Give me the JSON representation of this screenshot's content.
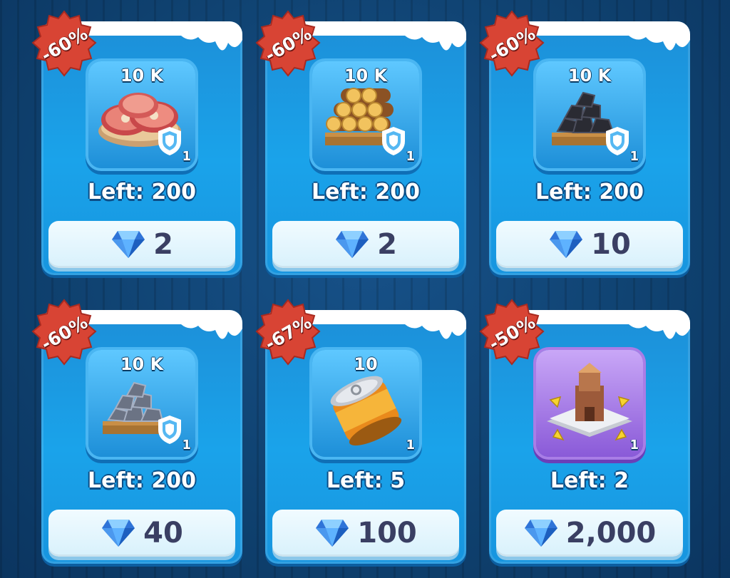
{
  "offers": [
    {
      "discount": "-60%",
      "quantity": "10 K",
      "item": "meat-icon",
      "stack": "1",
      "left": "Left: 200",
      "price": "2",
      "tile": "blue"
    },
    {
      "discount": "-60%",
      "quantity": "10 K",
      "item": "wood-logs-icon",
      "stack": "1",
      "left": "Left: 200",
      "price": "2",
      "tile": "blue"
    },
    {
      "discount": "-60%",
      "quantity": "10 K",
      "item": "coal-icon",
      "stack": "1",
      "left": "Left: 200",
      "price": "10",
      "tile": "blue"
    },
    {
      "discount": "-60%",
      "quantity": "10 K",
      "item": "iron-ore-icon",
      "stack": "1",
      "left": "Left: 200",
      "price": "40",
      "tile": "blue"
    },
    {
      "discount": "-67%",
      "quantity": "10",
      "item": "canned-food-icon",
      "stack": "1",
      "left": "Left: 5",
      "price": "100",
      "tile": "blue"
    },
    {
      "discount": "-50%",
      "quantity": "",
      "item": "relocation-teleport-icon",
      "stack": "1",
      "left": "Left: 2",
      "price": "2,000",
      "tile": "purple"
    }
  ],
  "colors": {
    "background": "#0f416f",
    "card": "#1aa3ea",
    "badge": "#d84434",
    "price_text": "#3a3f63",
    "gem": "#3f8ff0"
  }
}
